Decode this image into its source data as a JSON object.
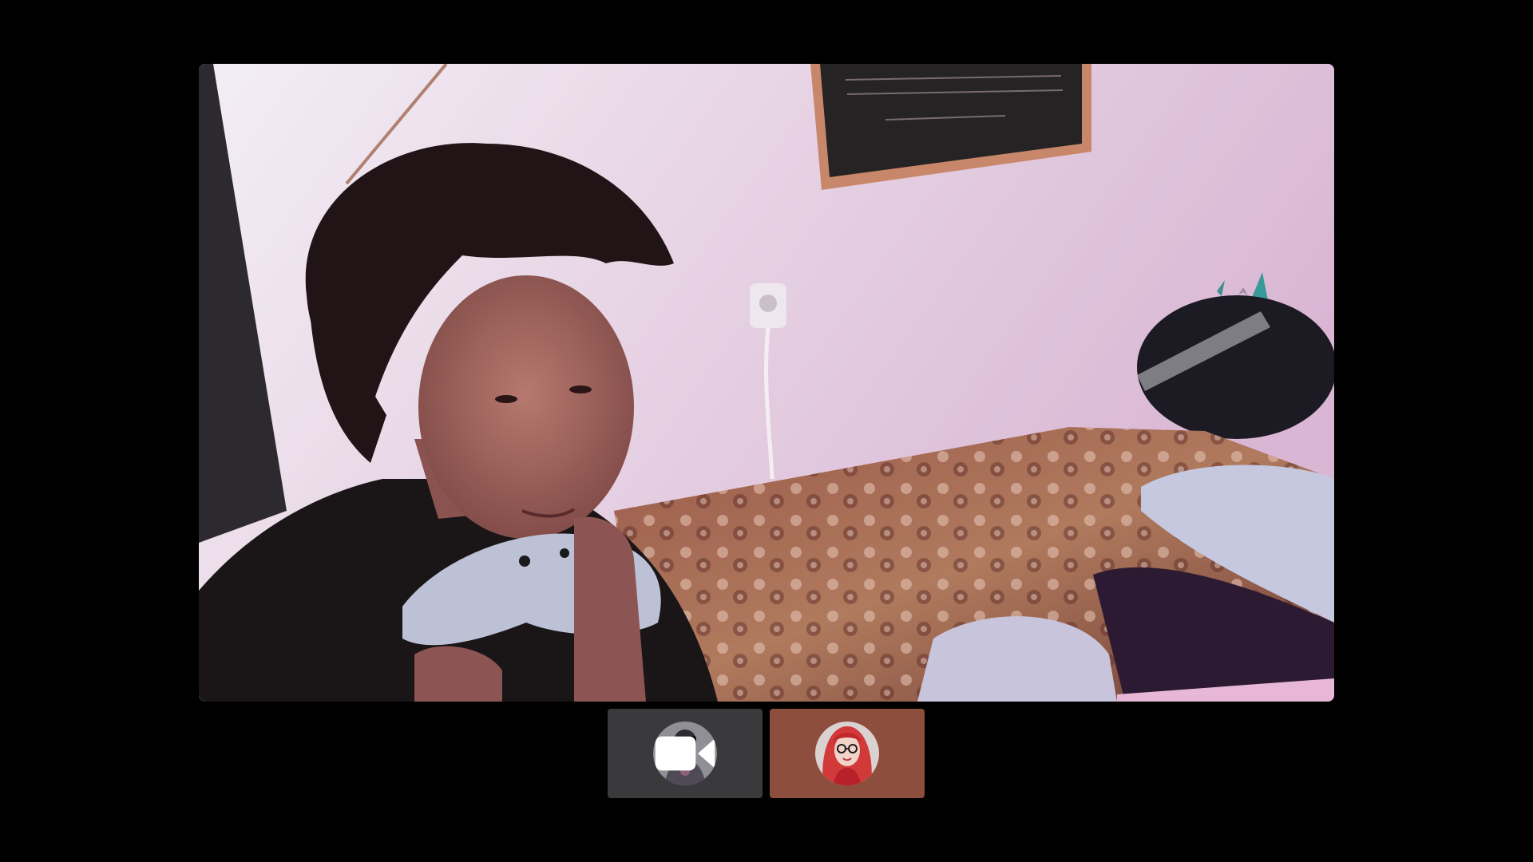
{
  "call": {
    "main_feed": {
      "label": "",
      "scene": "webcam-video-frame"
    },
    "participants": [
      {
        "name": "",
        "tile_color": "#3a3a3c",
        "avatar": "avatar-image",
        "overlay_icon": "video-camera-icon",
        "active": false
      },
      {
        "name": "",
        "tile_color": "#8e4e3e",
        "avatar": "avatar-image",
        "overlay_icon": "",
        "active": true
      }
    ]
  },
  "colors": {
    "background": "#000000",
    "tile_default": "#3a3a3c",
    "tile_active": "#8e4e3e"
  }
}
